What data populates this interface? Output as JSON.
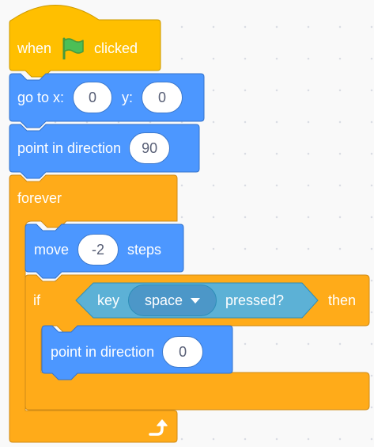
{
  "blocks": {
    "hat": {
      "label_when": "when",
      "icon": "green-flag-icon",
      "label_clicked": "clicked",
      "color": "#FFBF00"
    },
    "goto": {
      "label": "go to x:",
      "x": "0",
      "label_y": "y:",
      "y": "0",
      "color": "#4C97FF"
    },
    "point_in_direction": {
      "label": "point in direction",
      "value": "90",
      "color": "#4C97FF"
    },
    "forever": {
      "label": "forever",
      "color": "#FFAB19",
      "loop_icon": "loop-arrow-icon"
    },
    "move": {
      "label": "move",
      "value": "-2",
      "label_steps": "steps",
      "color": "#4C97FF"
    },
    "if_block": {
      "label_if": "if",
      "label_then": "then",
      "color": "#FFAB19"
    },
    "key_pressed": {
      "label_key": "key",
      "key": "space",
      "label_pressed": "pressed?",
      "color": "#5CB1D6",
      "dropdown_icon": "dropdown-caret-icon"
    },
    "inner_point": {
      "label": "point in direction",
      "value": "0",
      "color": "#4C97FF"
    }
  }
}
